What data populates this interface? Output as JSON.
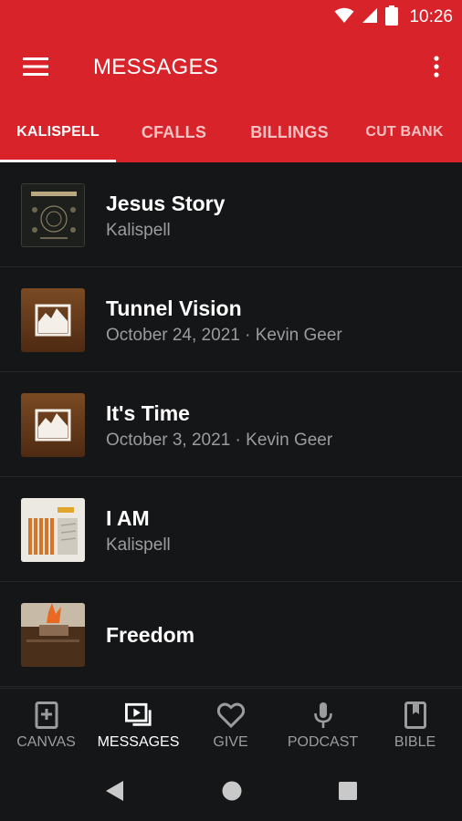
{
  "status_bar": {
    "time": "10:26"
  },
  "app_bar": {
    "title": "MESSAGES"
  },
  "tabs": [
    {
      "label": "KALISPELL",
      "active": true
    },
    {
      "label": "CFALLS",
      "active": false
    },
    {
      "label": "BILLINGS",
      "active": false
    },
    {
      "label": "CUT BANK",
      "active": false
    }
  ],
  "messages": [
    {
      "title": "Jesus Story",
      "subtitle": "Kalispell",
      "thumb": "jesus-story-art"
    },
    {
      "title": "Tunnel Vision",
      "subtitle": "October 24, 2021 · Kevin Geer",
      "thumb": "placeholder-image"
    },
    {
      "title": "It's Time",
      "subtitle": "October 3, 2021 · Kevin Geer",
      "thumb": "placeholder-image"
    },
    {
      "title": "I AM",
      "subtitle": "Kalispell",
      "thumb": "i-am-art"
    },
    {
      "title": "Freedom",
      "subtitle": "",
      "thumb": "freedom-art"
    }
  ],
  "bottom_nav": [
    {
      "label": "CANVAS",
      "icon": "bible-plus-icon",
      "active": false
    },
    {
      "label": "MESSAGES",
      "icon": "video-library-icon",
      "active": true
    },
    {
      "label": "GIVE",
      "icon": "heart-icon",
      "active": false
    },
    {
      "label": "PODCAST",
      "icon": "microphone-icon",
      "active": false
    },
    {
      "label": "BIBLE",
      "icon": "book-icon",
      "active": false
    }
  ],
  "colors": {
    "accent": "#d8232a",
    "background": "#151617",
    "muted_text": "#9b9c9e"
  }
}
